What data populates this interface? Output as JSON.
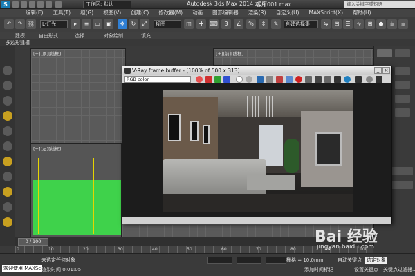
{
  "titlebar": {
    "workspace": "工作区: 默认",
    "app_title": "Autodesk 3ds Max  2014 x64",
    "file_name": "客厅001.max",
    "search_placeholder": "键入关键字或短语"
  },
  "menubar": [
    "编辑(E)",
    "工具(T)",
    "组(G)",
    "视图(V)",
    "创建(C)",
    "修改器(M)",
    "动画",
    "图形编辑器",
    "渲染(R)",
    "自定义(U)",
    "MAXScript(X)",
    "帮助(H)"
  ],
  "toolbar": {
    "filter_select": "L-灯光",
    "view_select": "视图",
    "named_select": "创建选择集"
  },
  "ribbon": {
    "tabs": [
      "建模",
      "自由形式",
      "选择",
      "对象绘制",
      "填充"
    ],
    "panel_label": "多边形建模"
  },
  "viewports": {
    "top_left_label": "[+][顶][线框]",
    "top_right_label": "[+][前][线框]",
    "bottom_left_label": "[+][左][线框]"
  },
  "vray": {
    "title": "V-Ray frame buffer - [100% of 500 x 313]",
    "channel": "RGB color"
  },
  "timeline": {
    "frame": "0 / 100",
    "ticks": [
      "0",
      "10",
      "20",
      "30",
      "40",
      "50",
      "60",
      "70",
      "80",
      "90",
      "100"
    ]
  },
  "status": {
    "welcome": "欢迎使用 MAXSc",
    "selection": "未选定任何对象",
    "render_time": "渲染时间 0:01:05",
    "grid": "栅格 = 10.0mm",
    "auto_key": "自动关键点",
    "selected": "选定对象",
    "add_time_tag": "添加时间标记",
    "set_key": "设置关键点",
    "key_filter": "关键点过滤器..."
  },
  "watermark": {
    "brand": "Bai 经验",
    "url": "jingyan.baidu.com"
  },
  "colors": {
    "accent": "#1a7db5",
    "viewport_bg": "#5a5a5a",
    "viewport_green": "#3de04a"
  }
}
